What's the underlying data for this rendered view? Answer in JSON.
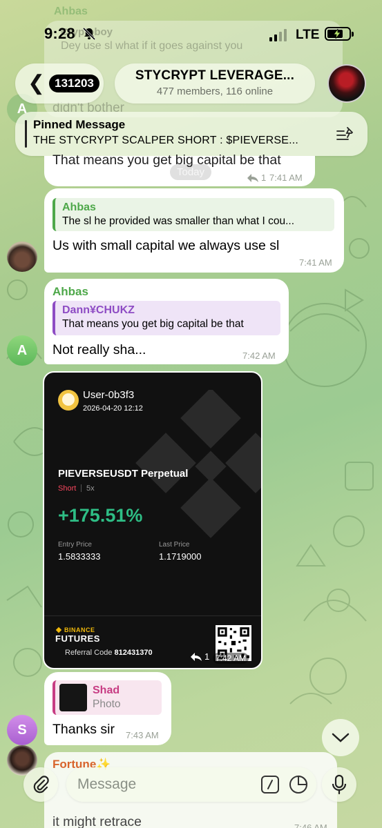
{
  "status_bar": {
    "time": "9:28",
    "network": "LTE"
  },
  "header": {
    "back_count": "131203",
    "title": "STYCRYPT LEVERAGE...",
    "subtitle": "477 members, 116 online"
  },
  "pinned": {
    "label": "Pinned Message",
    "text": "THE STYCRYPT SCALPER SHORT : $PIEVERSE..."
  },
  "background_faded": {
    "sender": "Ahbas",
    "reply_name": "Cryptoboy",
    "reply_text": "Dey use sl what if it goes against you",
    "line1": "didn't bother",
    "avatar_letter": "A"
  },
  "messages": {
    "m1": {
      "text": "That means you get big capital be that",
      "reply_count": "1",
      "time": "7:41 AM",
      "date_badge": "Today"
    },
    "m2": {
      "quote_name": "Ahbas",
      "quote_text": "The sl he provided was smaller than what I cou...",
      "text": "Us with small capital we always use sl",
      "time": "7:41 AM"
    },
    "m3": {
      "sender": "Ahbas",
      "quote_name": "Dann¥CHUKZ",
      "quote_text": "That means you get big capital be that",
      "text": "Not really sha...",
      "time": "7:42 AM",
      "avatar_letter": "A"
    },
    "m4": {
      "username": "User-0b3f3",
      "datetime": "2026-04-20 12:12",
      "pair": "PIEVERSEUSDT Perpetual",
      "side": "Short",
      "leverage": "5x",
      "pnl": "+175.51%",
      "entry_label": "Entry Price",
      "entry_value": "1.5833333",
      "last_label": "Last Price",
      "last_value": "1.1719000",
      "brand_top": "BINANCE",
      "brand_bottom": "FUTURES",
      "referral_label": "Referral Code",
      "referral_code": "812431370",
      "reply_count": "1",
      "time": "7:42 AM"
    },
    "m5": {
      "quote_name": "Shad",
      "quote_text": "Photo",
      "text": "Thanks sir",
      "time": "7:43 AM",
      "avatar_letter": "S"
    },
    "m6": {
      "sender": "Fortune✨",
      "text": "it might retrace",
      "time": "7:46 AM"
    }
  },
  "input": {
    "placeholder": "Message"
  },
  "colors": {
    "green_name": "#4ea84a",
    "purple_name": "#8e4cc4",
    "pink_name": "#c73c83",
    "pnl_green": "#2ebd85",
    "short_red": "#f6465d",
    "binance_yellow": "#f0b90b"
  },
  "icons": [
    "bell-off-icon",
    "signal-icon",
    "battery-icon",
    "chevron-left-icon",
    "pin-list-icon",
    "reply-arrow-icon",
    "chevron-down-icon",
    "paperclip-icon",
    "command-icon",
    "sticker-icon",
    "microphone-icon",
    "qr-code-icon",
    "binance-logo-icon"
  ]
}
